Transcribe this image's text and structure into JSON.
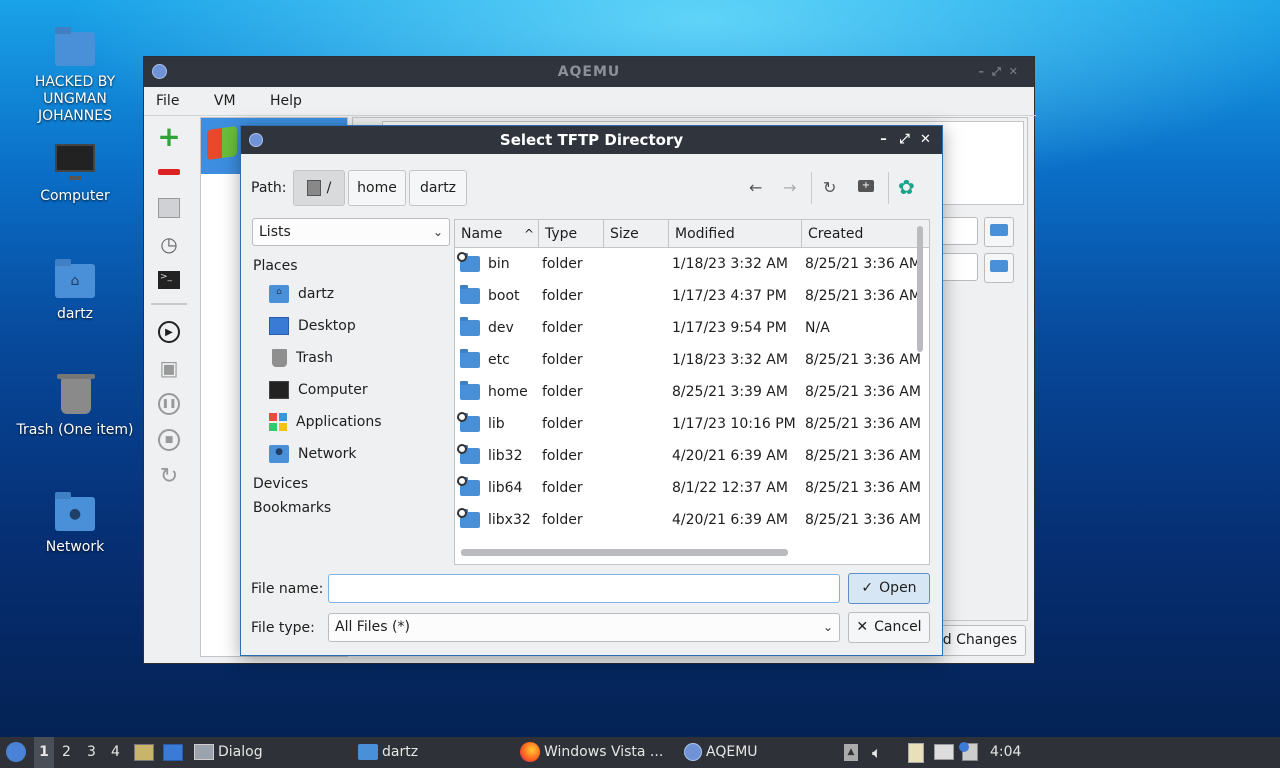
{
  "desktop": {
    "icons": [
      {
        "label": "HACKED BY UNGMAN JOHANNES",
        "icon": "folder-icon"
      },
      {
        "label": "Computer",
        "icon": "computer-icon"
      },
      {
        "label": "dartz",
        "icon": "home-folder-icon"
      },
      {
        "label": "Trash (One item)",
        "icon": "trash-icon"
      },
      {
        "label": "Network",
        "icon": "network-folder-icon"
      }
    ]
  },
  "aqemu": {
    "title": "AQEMU",
    "menu": [
      "File",
      "VM",
      "Help"
    ],
    "discard_label": "rd Changes"
  },
  "dialog": {
    "title": "Select TFTP Directory",
    "path_label": "Path:",
    "path_root": "/",
    "path_segments": [
      "home",
      "dartz"
    ],
    "view_combo": "Lists",
    "places_header": "Places",
    "places": [
      "dartz",
      "Desktop",
      "Trash",
      "Computer",
      "Applications",
      "Network"
    ],
    "devices_header": "Devices",
    "bookmarks_header": "Bookmarks",
    "columns": [
      "Name",
      "Type",
      "Size",
      "Modified",
      "Created"
    ],
    "files": [
      {
        "name": "bin",
        "type": "folder",
        "size": "",
        "modified": "1/18/23 3:32 AM",
        "created": "8/25/21 3:36 AM"
      },
      {
        "name": "boot",
        "type": "folder",
        "size": "",
        "modified": "1/17/23 4:37 PM",
        "created": "8/25/21 3:36 AM"
      },
      {
        "name": "dev",
        "type": "folder",
        "size": "",
        "modified": "1/17/23 9:54 PM",
        "created": "N/A"
      },
      {
        "name": "etc",
        "type": "folder",
        "size": "",
        "modified": "1/18/23 3:32 AM",
        "created": "8/25/21 3:36 AM"
      },
      {
        "name": "home",
        "type": "folder",
        "size": "",
        "modified": "8/25/21 3:39 AM",
        "created": "8/25/21 3:36 AM"
      },
      {
        "name": "lib",
        "type": "folder",
        "size": "",
        "modified": "1/17/23 10:16 PM",
        "created": "8/25/21 3:36 AM"
      },
      {
        "name": "lib32",
        "type": "folder",
        "size": "",
        "modified": "4/20/21 6:39 AM",
        "created": "8/25/21 3:36 AM"
      },
      {
        "name": "lib64",
        "type": "folder",
        "size": "",
        "modified": "8/1/22 12:37 AM",
        "created": "8/25/21 3:36 AM"
      },
      {
        "name": "libx32",
        "type": "folder",
        "size": "",
        "modified": "4/20/21 6:39 AM",
        "created": "8/25/21 3:36 AM"
      }
    ],
    "symlink_flags": [
      true,
      false,
      false,
      false,
      false,
      true,
      true,
      true,
      true
    ],
    "file_name_label": "File name:",
    "file_name_value": "",
    "file_type_label": "File type:",
    "file_type_value": "All Files (*)",
    "open_label": "Open",
    "cancel_label": "Cancel"
  },
  "taskbar": {
    "workspaces": [
      "1",
      "2",
      "3",
      "4"
    ],
    "active_workspace": "1",
    "tasks": [
      {
        "label": "Dialog",
        "icon": "window-icon"
      },
      {
        "label": "dartz",
        "icon": "folder-icon"
      },
      {
        "label": "Windows Vista ...",
        "icon": "firefox-icon"
      },
      {
        "label": "AQEMU",
        "icon": "aqemu-icon"
      }
    ],
    "clock": "4:04"
  },
  "colors": {
    "accent": "#2c6fb5",
    "folder": "#4a90d9",
    "titlebar": "#30343c",
    "taskbar": "#2e3138"
  }
}
